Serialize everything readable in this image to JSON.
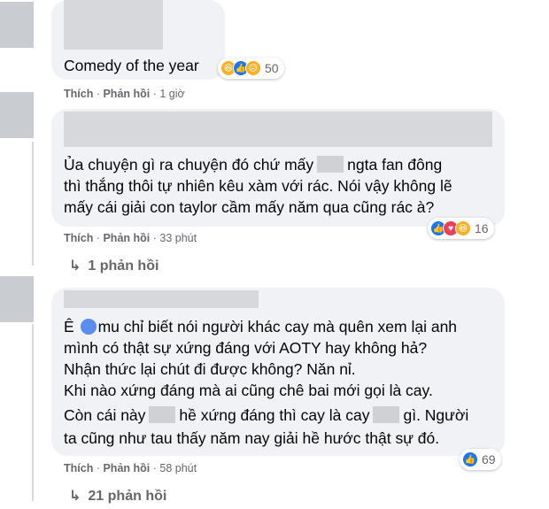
{
  "comments": [
    {
      "text": "Comedy of the year",
      "reaction_count": "50",
      "like_label": "Thích",
      "reply_label": "Phản hồi",
      "time": "1 giờ"
    },
    {
      "line1_a": "Ủa chuyện gì ra chuyện đó chứ mấy",
      "line1_b": "ngta fan đông",
      "line2": "thì thắng thôi tự nhiên kêu xàm với rác. Nói vậy không lẽ",
      "line3": "mấy cái giải con taylor cầm mấy năm qua cũng rác à?",
      "reaction_count": "16",
      "like_label": "Thích",
      "reply_label": "Phản hồi",
      "time": "33 phút",
      "replies_link": "1 phản hồi"
    },
    {
      "line1_a": "Ê",
      "line1_b": "mu chỉ biết nói người khác cay mà quên xem lại anh",
      "line2": "mình có thật sự xứng đáng với AOTY hay không hả?",
      "line3": "Nhận thức lại chút đi được không? Năn nỉ.",
      "line4": "Khi nào xứng đáng mà ai cũng chê bai mới gọi là cay.",
      "line5_a": "Còn cái này",
      "line5_b": "hề xứng đáng thì cay là cay",
      "line5_c": "gì. Người",
      "line6": "ta cũng như tau thấy năm nay giải hề hước thật sự đó.",
      "reaction_count": "69",
      "like_label": "Thích",
      "reply_label": "Phản hồi",
      "time": "58 phút",
      "replies_link": "21 phản hồi"
    }
  ],
  "colors": {
    "bubble": "#f0f2f5",
    "meta": "#65676b",
    "like_blue": "#1877f2",
    "love_red": "#f33e58",
    "haha_yellow": "#f7b125"
  }
}
